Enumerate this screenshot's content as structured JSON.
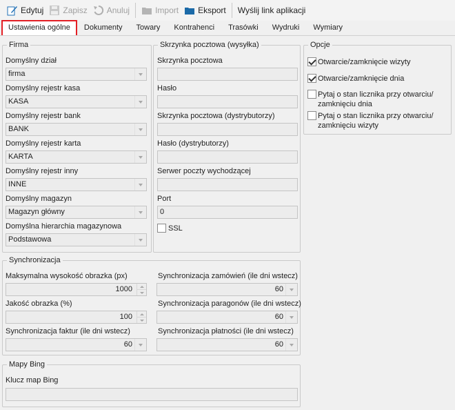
{
  "toolbar": {
    "edit": "Edytuj",
    "save": "Zapisz",
    "cancel": "Anuluj",
    "import": "Import",
    "export": "Eksport",
    "send_link": "Wyślij link aplikacji"
  },
  "tabs": [
    "Ustawienia ogólne",
    "Dokumenty",
    "Towary",
    "Kontrahenci",
    "Trasówki",
    "Wydruki",
    "Wymiary"
  ],
  "firma": {
    "title": "Firma",
    "fields": [
      {
        "label": "Domyślny dział",
        "value": "firma"
      },
      {
        "label": "Domyślny rejestr kasa",
        "value": "KASA"
      },
      {
        "label": "Domyślny rejestr bank",
        "value": "BANK"
      },
      {
        "label": "Domyślny rejestr karta",
        "value": "KARTA"
      },
      {
        "label": "Domyślny rejestr inny",
        "value": "INNE"
      },
      {
        "label": "Domyślny magazyn",
        "value": "Magazyn główny"
      },
      {
        "label": "Domyślna hierarchia magazynowa",
        "value": "Podstawowa"
      }
    ]
  },
  "mail": {
    "title": "Skrzynka pocztowa (wysyłka)",
    "fields": [
      {
        "label": "Skrzynka pocztowa",
        "value": ""
      },
      {
        "label": "Hasło",
        "value": ""
      },
      {
        "label": "Skrzynka pocztowa (dystrybutorzy)",
        "value": ""
      },
      {
        "label": "Hasło (dystrybutorzy)",
        "value": ""
      },
      {
        "label": "Serwer poczty wychodzącej",
        "value": ""
      },
      {
        "label": "Port",
        "value": "0"
      }
    ],
    "ssl_label": "SSL",
    "ssl_checked": false
  },
  "options": {
    "title": "Opcje",
    "items": [
      {
        "label": "Otwarcie/zamknięcie wizyty",
        "checked": true
      },
      {
        "label": "Otwarcie/zamknięcie dnia",
        "checked": true
      },
      {
        "label": "Pytaj o stan licznika przy otwarciu/ zamknięciu dnia",
        "checked": false
      },
      {
        "label": "Pytaj o stan licznika przy otwarciu/ zamknięciu wizyty",
        "checked": false
      }
    ]
  },
  "sync": {
    "title": "Synchronizacja",
    "max_height": {
      "label": "Maksymalna wysokość obrazka (px)",
      "value": "1000"
    },
    "quality": {
      "label": "Jakość obrazka (%)",
      "value": "100"
    },
    "invoices": {
      "label": "Synchronizacja faktur (ile dni wstecz)",
      "value": "60"
    },
    "orders": {
      "label": "Synchronizacja zamówień (ile dni wstecz)",
      "value": "60"
    },
    "receipts": {
      "label": "Synchronizacja paragonów (ile dni wstecz)",
      "value": "60"
    },
    "payments": {
      "label": "Synchronizacja płatności (ile dni wstecz)",
      "value": "60"
    }
  },
  "bing": {
    "title": "Mapy Bing",
    "key_label": "Klucz map Bing",
    "key_value": ""
  }
}
